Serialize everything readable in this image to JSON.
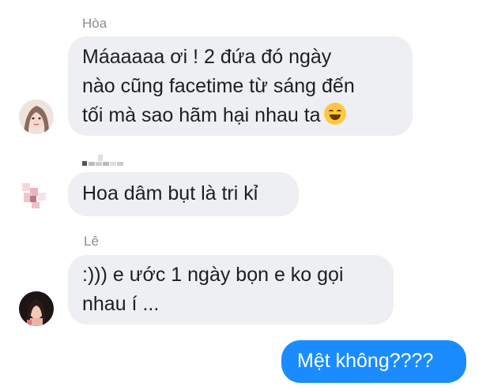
{
  "messages": [
    {
      "sender": "Hòa",
      "lines": [
        "Máaaaaa ơi ! 2 đứa đó ngày",
        "nào cũng facetime từ sáng đến",
        "tối mà sao hãm hại nhau ta"
      ],
      "emoji": "rofl-emoji"
    },
    {
      "sender": "",
      "lines": [
        "Hoa dâm bụt là tri kỉ"
      ]
    },
    {
      "sender": "Lê",
      "lines": [
        ":))) e ước 1 ngày bọn e ko gọi",
        "nhau í ..."
      ]
    },
    {
      "outgoing": true,
      "lines": [
        "Mệt không????"
      ]
    }
  ],
  "colors": {
    "incoming_bubble": "#eeeff2",
    "outgoing_bubble": "#1a8cff",
    "sender_name": "#8a8d91"
  }
}
